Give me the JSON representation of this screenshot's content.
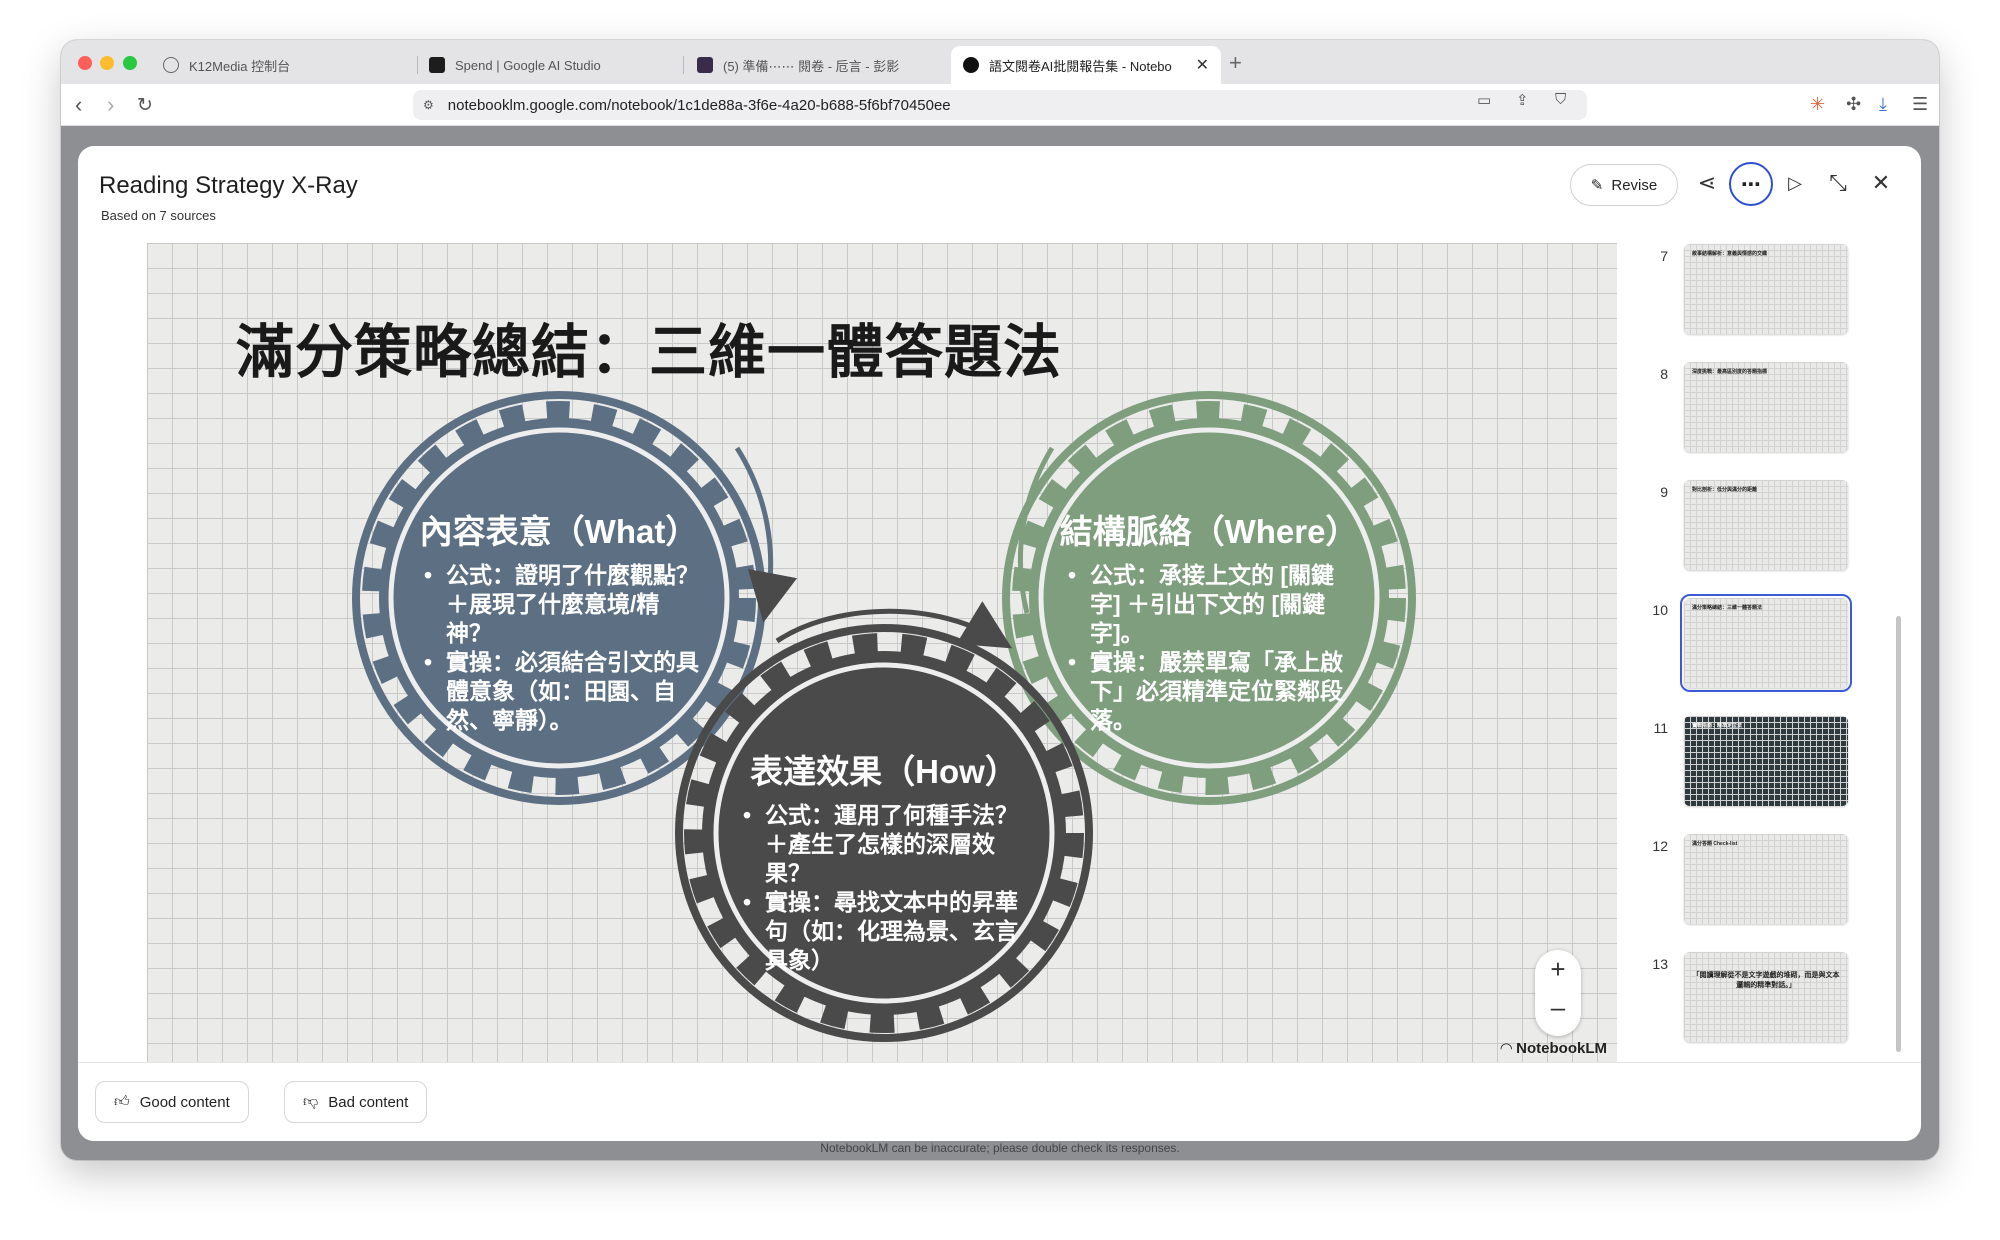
{
  "browser": {
    "tabs": [
      {
        "title": "K12Media 控制台",
        "icon": "globe-icon",
        "active": false
      },
      {
        "title": "Spend | Google AI Studio",
        "icon": "ai-studio-icon",
        "active": false
      },
      {
        "title": "(5) 準備⋯⋯ 閱卷 - 卮言 - 彭影",
        "icon": "site-icon",
        "active": false
      },
      {
        "title": "語文閱卷AI批閱報告集 - Notebo",
        "icon": "notebooklm-icon",
        "active": true
      }
    ],
    "new_tab_label": "+",
    "url": "notebooklm.google.com/notebook/1c1de88a-3f6e-4a20-b688-5f6bf70450ee"
  },
  "dialog": {
    "title": "Reading Strategy X-Ray",
    "subtitle": "Based on 7 sources",
    "revise_label": "Revise",
    "header_icons": [
      "share-icon",
      "more-icon",
      "play-icon",
      "collapse-icon",
      "close-icon"
    ]
  },
  "slide": {
    "heading": "滿分策略總結：三維一體答題法",
    "gears": [
      {
        "title": "內容表意（What）",
        "color": "#5c6f83",
        "bullets": [
          "公式：證明了什麼觀點？＋展現了什麼意境/精神？",
          "實操：必須結合引文的具體意象（如：田園、自然、寧靜）。"
        ]
      },
      {
        "title": "結構脈絡（Where）",
        "color": "#7e9e7e",
        "bullets": [
          "公式：承接上文的 [關鍵字] ＋引出下文的 [關鍵字]。",
          "實操：嚴禁單寫「承上啟下」必須精準定位緊鄰段落。"
        ]
      },
      {
        "title": "表達效果（How）",
        "color": "#4a4a4a",
        "bullets": [
          "公式：運用了何種手法？＋產生了怎樣的深層效果？",
          "實操：尋找文本中的昇華句（如：化理為景、玄言具象）"
        ]
      }
    ],
    "watermark": "NotebookLM",
    "zoom_in": "+",
    "zoom_out": "–"
  },
  "thumbnails": [
    {
      "number": "7",
      "title": "敘事結構解析：意義與情感的交織",
      "active": false
    },
    {
      "number": "8",
      "title": "深度挑戰：最高區別度的答題指標",
      "active": false
    },
    {
      "number": "9",
      "title": "對比剖析：低分與滿分的距離",
      "active": false
    },
    {
      "number": "10",
      "title": "滿分策略總結：三維一體答題法",
      "active": true
    },
    {
      "number": "11",
      "title": "實戰指南：精準定位法",
      "active": false
    },
    {
      "number": "12",
      "title": "滿分答題 Check-list",
      "active": false
    },
    {
      "number": "13",
      "title": "「閱讀理解從不是文字遊戲的堆砌，而是與文本邏輯的精準對話。」",
      "active": false
    }
  ],
  "footer": {
    "good_label": "Good content",
    "bad_label": "Bad content",
    "disclaimer": "NotebookLM can be inaccurate; please double check its responses."
  }
}
